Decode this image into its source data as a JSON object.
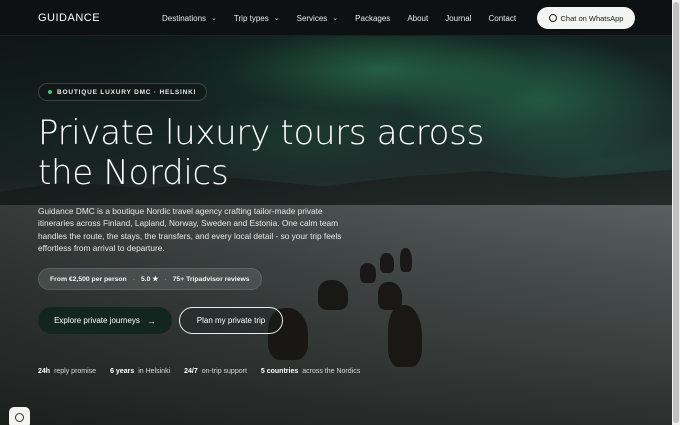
{
  "header": {
    "logo": "GUIDANCE",
    "nav": [
      {
        "label": "Destinations",
        "dropdown": true
      },
      {
        "label": "Trip types",
        "dropdown": true
      },
      {
        "label": "Services",
        "dropdown": true
      },
      {
        "label": "Packages",
        "dropdown": false
      },
      {
        "label": "About",
        "dropdown": false
      },
      {
        "label": "Journal",
        "dropdown": false
      },
      {
        "label": "Contact",
        "dropdown": false
      }
    ],
    "cta_label": "Chat on WhatsApp",
    "cta_icon": "whatsapp-icon"
  },
  "hero": {
    "badge": "BOUTIQUE LUXURY DMC · HELSINKI",
    "title_line1": "Private luxury tours across",
    "title_line2": "the Nordics",
    "description": "Guidance DMC is a boutique Nordic travel agency crafting tailor-made private itineraries across Finland, Lapland, Norway, Sweden and Estonia. One calm team handles the route, the stays, the transfers, and every local detail - so your trip feels effortless from arrival to departure.",
    "stats": {
      "price": "From €2,500 per person",
      "rating": "5.0 ★",
      "reviews": "75+ Tripadvisor reviews",
      "separator": "·"
    },
    "primary_button": "Explore private journeys",
    "primary_arrow": "→",
    "secondary_button": "Plan my private trip",
    "facts": [
      {
        "value": "24h",
        "label": "reply promise"
      },
      {
        "value": "6 years",
        "label": "in Helsinki"
      },
      {
        "value": "24/7",
        "label": "on-trip support"
      },
      {
        "value": "5 countries",
        "label": "across the Nordics"
      }
    ]
  },
  "cookie_icon": "cookie-icon",
  "colors": {
    "header_bg": "#0e1111",
    "primary_button_bg": "#13251f",
    "accent_green": "#4fbf8a",
    "cta_bg": "#f4f5f2"
  }
}
